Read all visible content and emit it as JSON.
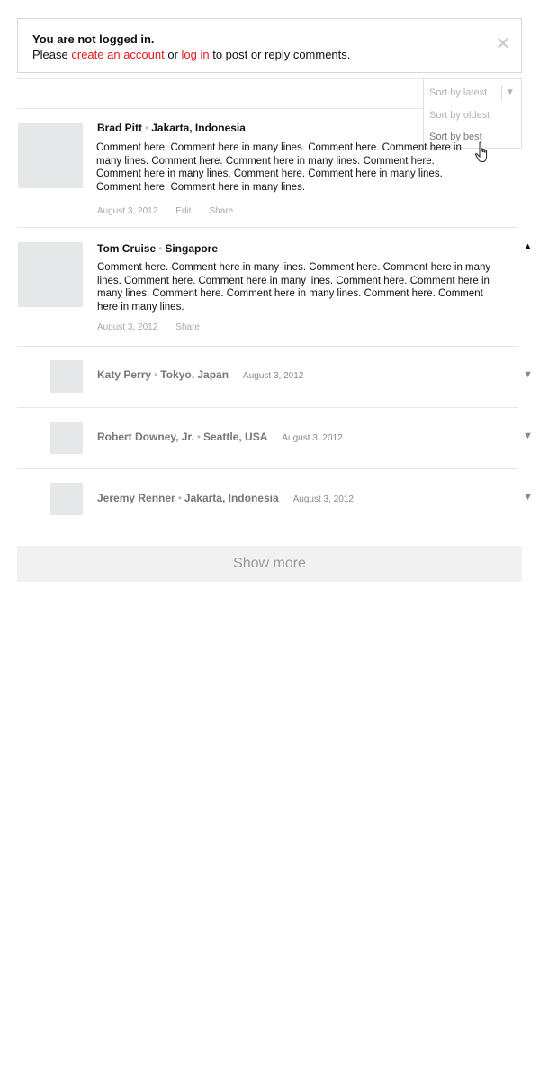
{
  "notice": {
    "title": "You are not logged in.",
    "text_before": "Please ",
    "link_create": "create an account",
    "text_middle": " or ",
    "link_login": "log in",
    "text_after": " to post or reply comments.",
    "close_icon": "close-icon"
  },
  "sort": {
    "options": [
      "Sort by latest",
      "Sort by oldest",
      "Sort by best"
    ],
    "selected": "Sort by latest",
    "hovered": "Sort by best"
  },
  "comments": [
    {
      "name": "Brad Pitt",
      "location": "Jakarta, Indonesia",
      "body": "Comment here. Comment here in many lines. Comment here. Comment here in many lines. Comment here. Comment here in many lines. Comment here. Comment here in many lines. Comment here. Comment here in many lines. Comment here. Comment here in many lines.",
      "date": "August 3, 2012",
      "actions": [
        "Edit",
        "Share"
      ]
    },
    {
      "name": "Tom Cruise",
      "location": "Singapore",
      "body": "Comment here. Comment here in many lines. Comment here. Comment here in many lines. Comment here. Comment here in many lines. Comment here. Comment here in many lines. Comment here. Comment here in many lines. Comment here. Comment here in many lines.",
      "date": "August 3, 2012",
      "actions": [
        "Share"
      ],
      "expanded": true
    }
  ],
  "replies": [
    {
      "name": "Katy Perry",
      "location": "Tokyo, Japan",
      "date": "August 3, 2012"
    },
    {
      "name": "Robert Downey, Jr.",
      "location": "Seattle, USA",
      "date": "August 3, 2012"
    },
    {
      "name": "Jeremy Renner",
      "location": "Jakarta, Indonesia",
      "date": "August 3, 2012"
    }
  ],
  "show_more": "Show more",
  "colors": {
    "link": "#e01b1b",
    "avatar": "#e6e7e9",
    "divider": "#e6e6e6"
  }
}
